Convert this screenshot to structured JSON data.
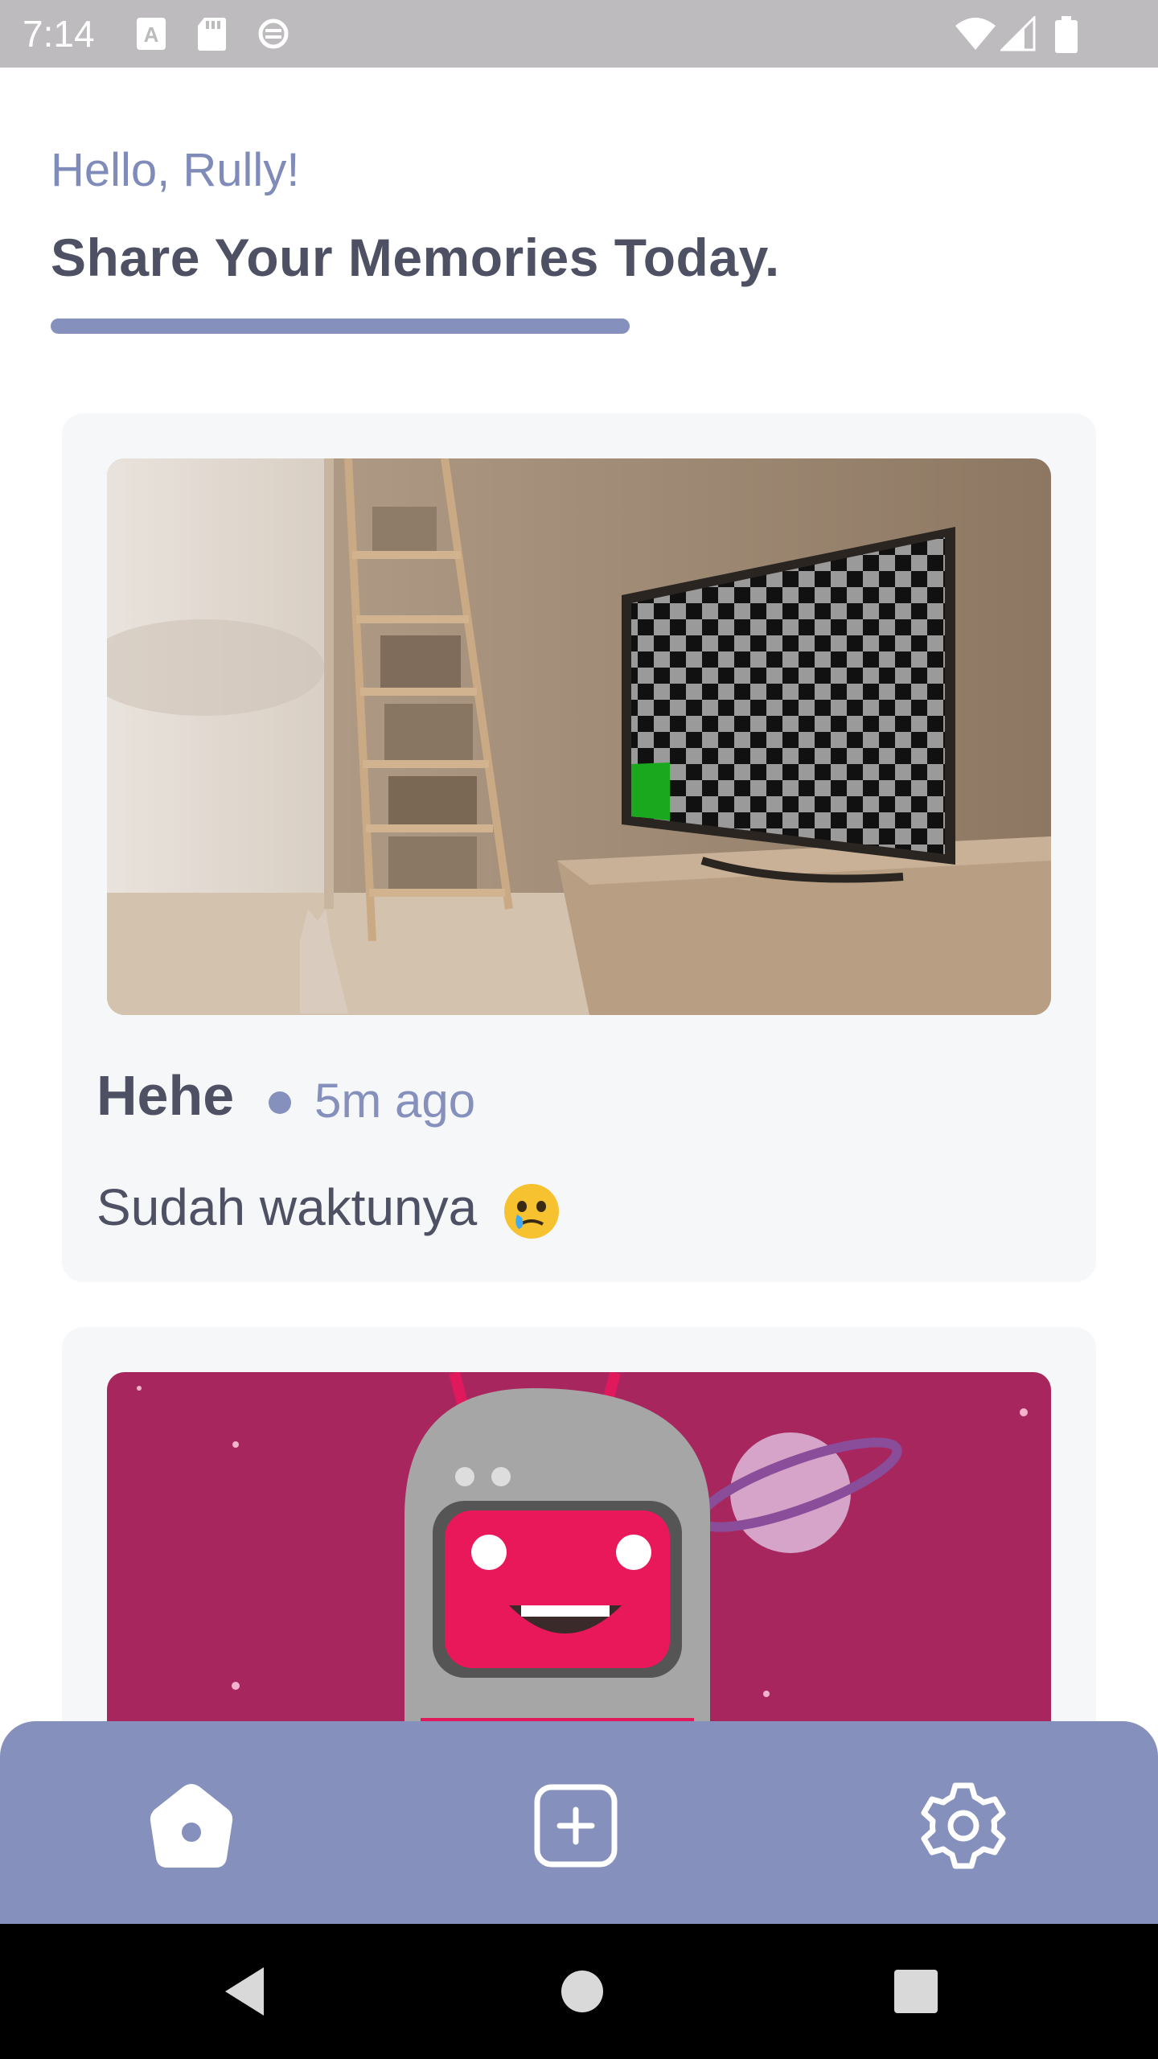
{
  "status_bar": {
    "time": "7:14",
    "icons": [
      "font-icon",
      "sd-card-icon",
      "data-saver-icon",
      "wifi-icon",
      "cell-signal-icon",
      "battery-icon"
    ]
  },
  "header": {
    "greeting": "Hello, Rully!",
    "headline": "Share Your Memories Today."
  },
  "posts": [
    {
      "title": "Hehe",
      "time": "5m ago",
      "body": "Sudah waktunya",
      "emoji": "face-holding-back-tears-icon",
      "image": "living-room-tv-checkerboard-image"
    },
    {
      "image": "pink-robot-astronaut-image"
    }
  ],
  "bottom_nav": {
    "items": [
      "home-icon",
      "add-post-icon",
      "settings-icon"
    ]
  },
  "colors": {
    "accent": "#8590bd",
    "text_dark": "#4d5163",
    "card_bg": "#f6f7f9"
  }
}
